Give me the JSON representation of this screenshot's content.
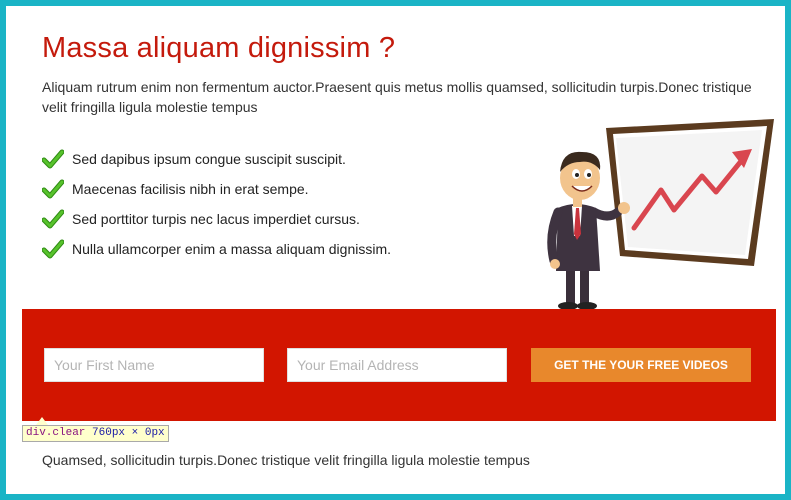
{
  "hero": {
    "heading": "Massa aliquam dignissim ?",
    "intro": "Aliquam rutrum enim non fermentum auctor.Praesent quis metus mollis quamsed, sollicitudin turpis.Donec tristique velit fringilla ligula molestie tempus",
    "features": [
      {
        "text": "Sed dapibus ipsum congue suscipit suscipit.",
        "icon": "checkmark-icon"
      },
      {
        "text": "Maecenas facilisis nibh in erat sempe.",
        "icon": "checkmark-icon"
      },
      {
        "text": "Sed porttitor turpis nec lacus imperdiet cursus.",
        "icon": "checkmark-icon"
      },
      {
        "text": "Nulla ullamcorper enim a massa aliquam dignissim.",
        "icon": "checkmark-icon"
      }
    ],
    "illustration": "businessman-presenting-growth-chart"
  },
  "signup": {
    "first_name_placeholder": "Your First Name",
    "first_name_value": "",
    "email_placeholder": "Your Email Address",
    "email_value": "",
    "button_label": "GET THE YOUR FREE VIDEOS"
  },
  "devtools_tooltip": {
    "selector": "div.clear",
    "dimensions": "760px × 0px"
  },
  "footer": {
    "text": "Quamsed, sollicitudin turpis.Donec tristique velit fringilla ligula molestie tempus"
  },
  "colors": {
    "frame_border": "#1ab4c6",
    "heading": "#c41a0c",
    "cta_band": "#d21500",
    "cta_button": "#e8882c",
    "check": "#3aa51c"
  }
}
